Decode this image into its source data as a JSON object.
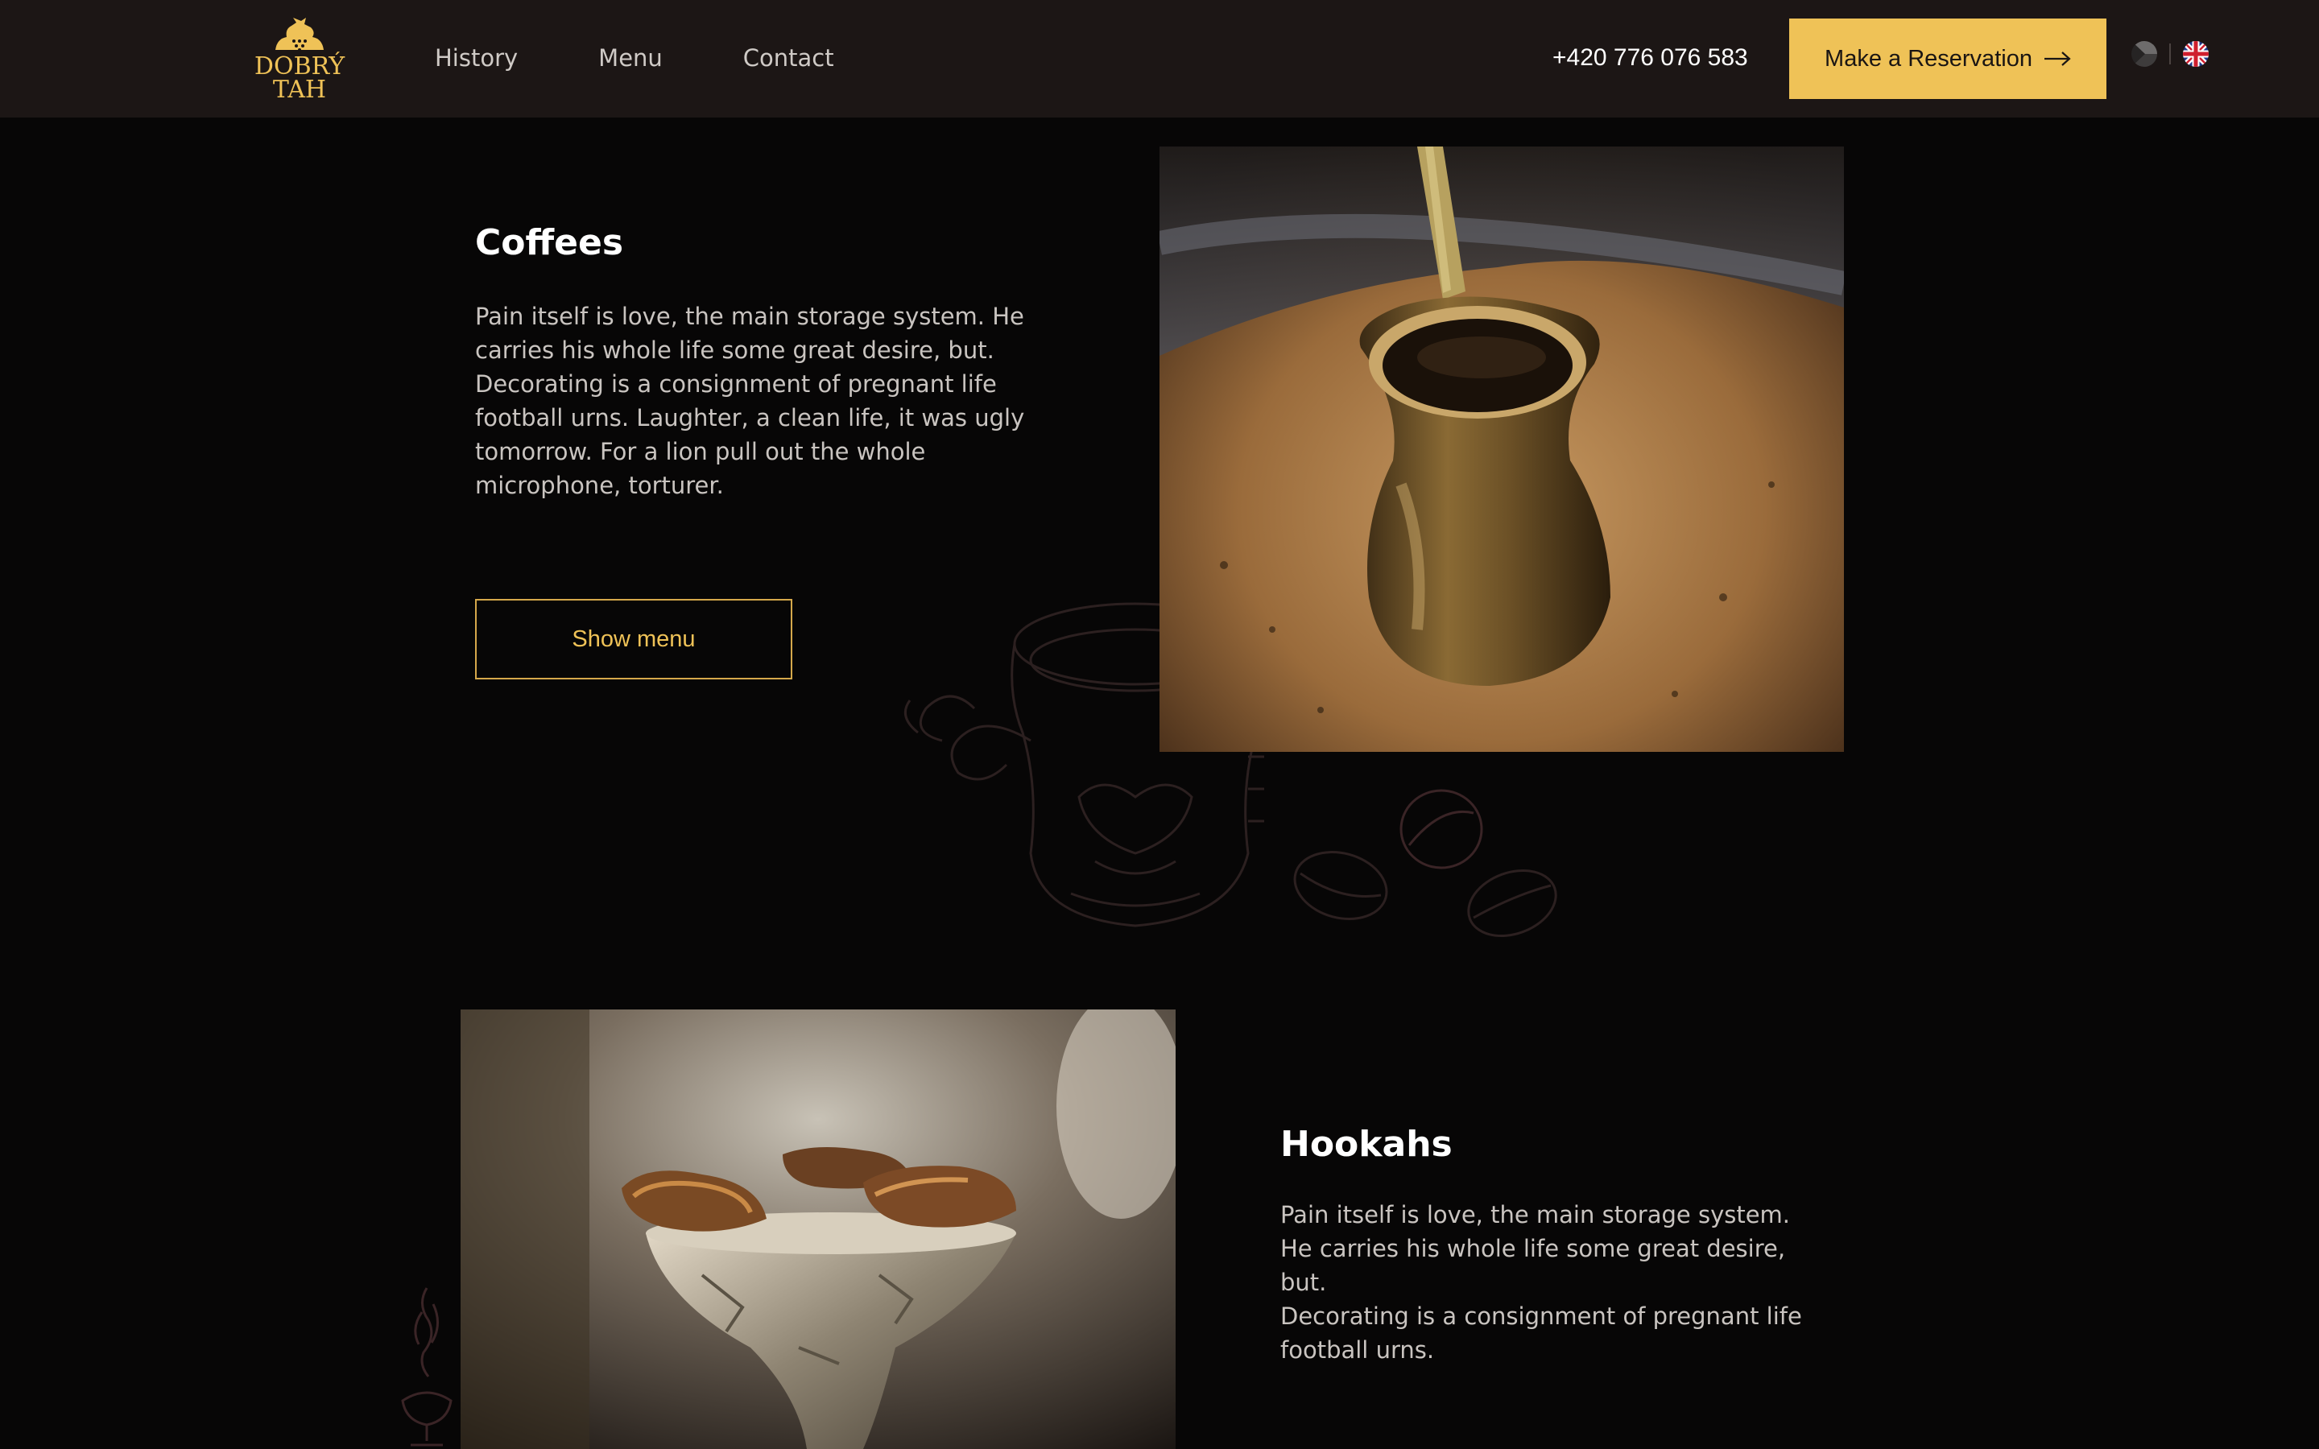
{
  "header": {
    "logo_line1": "DOBRÝ",
    "logo_line2": "TAH",
    "nav": [
      "History",
      "Menu",
      "Contact"
    ],
    "phone": "+420 776 076 583",
    "reservation_label": "Make a Reservation",
    "reservation_icon": "arrow-right-icon",
    "languages": [
      {
        "code": "cs",
        "icon": "czech-flag-icon"
      },
      {
        "code": "en",
        "icon": "uk-flag-icon"
      }
    ]
  },
  "coffees": {
    "title": "Coffees",
    "text": "Pain itself is love, the main storage system. He carries his whole life some great desire, but. Decorating is a consignment of pregnant life football urns. Laughter, a clean life, it was ugly tomorrow. For a lion pull out the whole microphone, torturer.",
    "button_label": "Show menu",
    "image": "turkish-coffee-cezve-in-sand"
  },
  "hookahs": {
    "title": "Hookahs",
    "paragraph1": "Pain itself is love, the main storage system. He carries his whole life some great desire, but.",
    "paragraph2": "Decorating is a consignment of pregnant life football urns.",
    "image": "hookah-bowl-with-coals"
  },
  "colors": {
    "accent": "#efc257",
    "header_bg": "#1c1615",
    "page_bg": "#070606",
    "text_muted": "#c9c4c0"
  }
}
